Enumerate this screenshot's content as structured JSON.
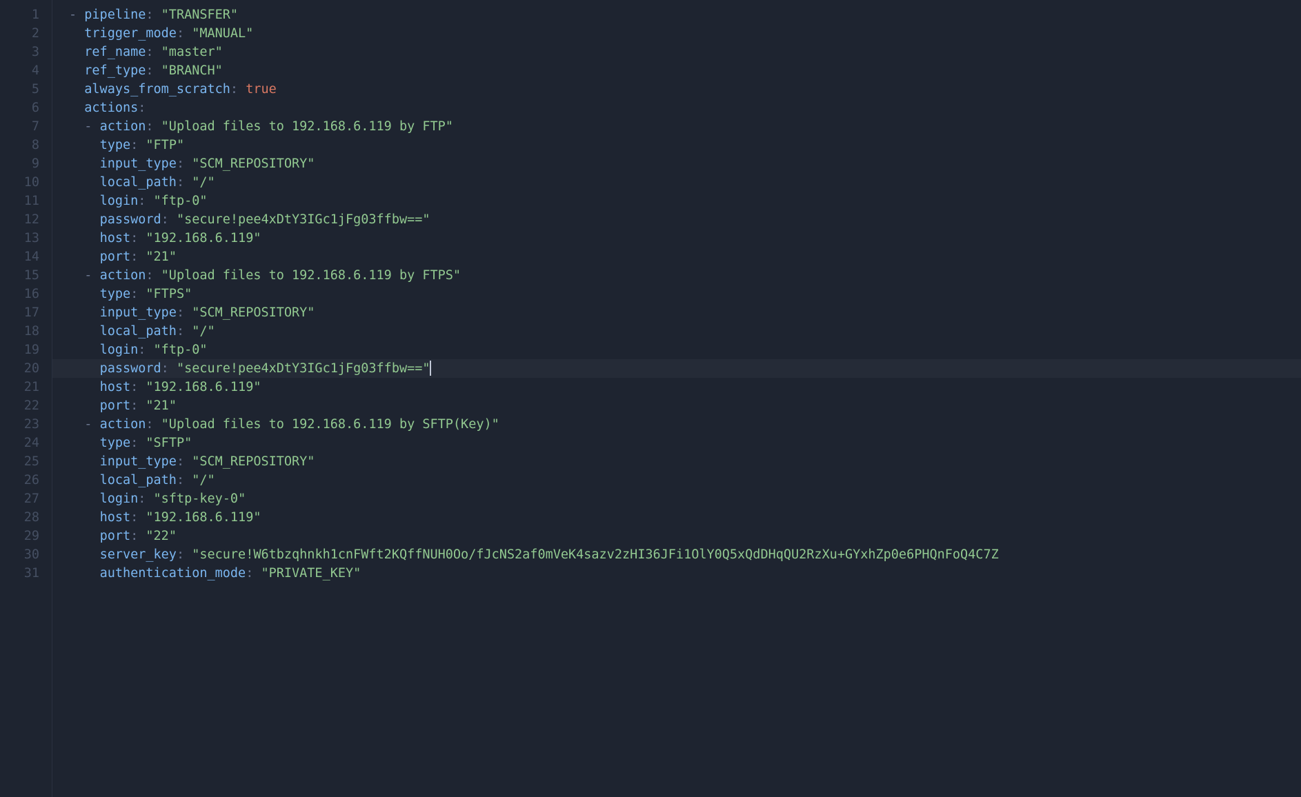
{
  "colors": {
    "background": "#1e2430",
    "gutter_text": "#454f62",
    "key": "#7bb6f0",
    "string": "#92c990",
    "boolean": "#d97862",
    "punctuation": "#6b7690",
    "default": "#c1c8d6"
  },
  "active_line": 20,
  "cursor_at_end_of_line": 20,
  "lines": [
    {
      "n": "1",
      "indent": 0,
      "dash": true,
      "key": "pipeline",
      "val": "\"TRANSFER\"",
      "vt": "str"
    },
    {
      "n": "2",
      "indent": 1,
      "dash": false,
      "key": "trigger_mode",
      "val": "\"MANUAL\"",
      "vt": "str"
    },
    {
      "n": "3",
      "indent": 1,
      "dash": false,
      "key": "ref_name",
      "val": "\"master\"",
      "vt": "str"
    },
    {
      "n": "4",
      "indent": 1,
      "dash": false,
      "key": "ref_type",
      "val": "\"BRANCH\"",
      "vt": "str"
    },
    {
      "n": "5",
      "indent": 1,
      "dash": false,
      "key": "always_from_scratch",
      "val": "true",
      "vt": "bool"
    },
    {
      "n": "6",
      "indent": 1,
      "dash": false,
      "key": "actions",
      "val": "",
      "vt": "none"
    },
    {
      "n": "7",
      "indent": 1,
      "dash": true,
      "key": "action",
      "val": "\"Upload files to 192.168.6.119 by FTP\"",
      "vt": "str"
    },
    {
      "n": "8",
      "indent": 2,
      "dash": false,
      "key": "type",
      "val": "\"FTP\"",
      "vt": "str"
    },
    {
      "n": "9",
      "indent": 2,
      "dash": false,
      "key": "input_type",
      "val": "\"SCM_REPOSITORY\"",
      "vt": "str"
    },
    {
      "n": "10",
      "indent": 2,
      "dash": false,
      "key": "local_path",
      "val": "\"/\"",
      "vt": "str"
    },
    {
      "n": "11",
      "indent": 2,
      "dash": false,
      "key": "login",
      "val": "\"ftp-0\"",
      "vt": "str"
    },
    {
      "n": "12",
      "indent": 2,
      "dash": false,
      "key": "password",
      "val": "\"secure!pee4xDtY3IGc1jFg03ffbw==\"",
      "vt": "str"
    },
    {
      "n": "13",
      "indent": 2,
      "dash": false,
      "key": "host",
      "val": "\"192.168.6.119\"",
      "vt": "str"
    },
    {
      "n": "14",
      "indent": 2,
      "dash": false,
      "key": "port",
      "val": "\"21\"",
      "vt": "str"
    },
    {
      "n": "15",
      "indent": 1,
      "dash": true,
      "key": "action",
      "val": "\"Upload files to 192.168.6.119 by FTPS\"",
      "vt": "str"
    },
    {
      "n": "16",
      "indent": 2,
      "dash": false,
      "key": "type",
      "val": "\"FTPS\"",
      "vt": "str"
    },
    {
      "n": "17",
      "indent": 2,
      "dash": false,
      "key": "input_type",
      "val": "\"SCM_REPOSITORY\"",
      "vt": "str"
    },
    {
      "n": "18",
      "indent": 2,
      "dash": false,
      "key": "local_path",
      "val": "\"/\"",
      "vt": "str"
    },
    {
      "n": "19",
      "indent": 2,
      "dash": false,
      "key": "login",
      "val": "\"ftp-0\"",
      "vt": "str"
    },
    {
      "n": "20",
      "indent": 2,
      "dash": false,
      "key": "password",
      "val": "\"secure!pee4xDtY3IGc1jFg03ffbw==\"",
      "vt": "str"
    },
    {
      "n": "21",
      "indent": 2,
      "dash": false,
      "key": "host",
      "val": "\"192.168.6.119\"",
      "vt": "str"
    },
    {
      "n": "22",
      "indent": 2,
      "dash": false,
      "key": "port",
      "val": "\"21\"",
      "vt": "str"
    },
    {
      "n": "23",
      "indent": 1,
      "dash": true,
      "key": "action",
      "val": "\"Upload files to 192.168.6.119 by SFTP(Key)\"",
      "vt": "str"
    },
    {
      "n": "24",
      "indent": 2,
      "dash": false,
      "key": "type",
      "val": "\"SFTP\"",
      "vt": "str"
    },
    {
      "n": "25",
      "indent": 2,
      "dash": false,
      "key": "input_type",
      "val": "\"SCM_REPOSITORY\"",
      "vt": "str"
    },
    {
      "n": "26",
      "indent": 2,
      "dash": false,
      "key": "local_path",
      "val": "\"/\"",
      "vt": "str"
    },
    {
      "n": "27",
      "indent": 2,
      "dash": false,
      "key": "login",
      "val": "\"sftp-key-0\"",
      "vt": "str"
    },
    {
      "n": "28",
      "indent": 2,
      "dash": false,
      "key": "host",
      "val": "\"192.168.6.119\"",
      "vt": "str"
    },
    {
      "n": "29",
      "indent": 2,
      "dash": false,
      "key": "port",
      "val": "\"22\"",
      "vt": "str"
    },
    {
      "n": "30",
      "indent": 2,
      "dash": false,
      "key": "server_key",
      "val": "\"secure!W6tbzqhnkh1cnFWft2KQffNUH0Oo/fJcNS2af0mVeK4sazv2zHI36JFi1OlY0Q5xQdDHqQU2RzXu+GYxhZp0e6PHQnFoQ4C7Z",
      "vt": "str"
    },
    {
      "n": "31",
      "indent": 2,
      "dash": false,
      "key": "authentication_mode",
      "val": "\"PRIVATE_KEY\"",
      "vt": "str"
    }
  ]
}
